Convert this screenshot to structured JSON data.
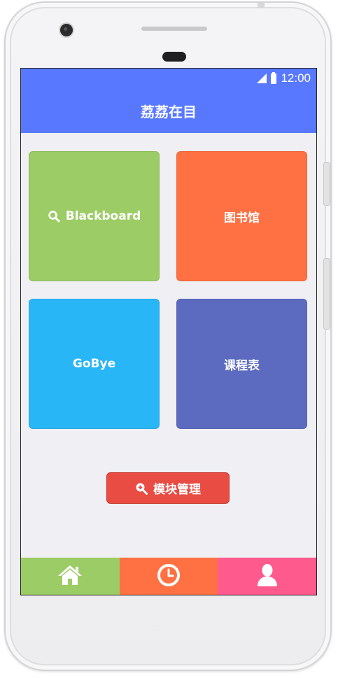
{
  "status_bar": {
    "time": "12:00",
    "signal_icon": "signal-icon",
    "battery_icon": "battery-icon"
  },
  "app_bar": {
    "title": "荔荔在目"
  },
  "tiles": [
    {
      "label": "Blackboard",
      "icon": "search-icon",
      "color": "#9ccc65"
    },
    {
      "label": "图书馆",
      "color": "#ff7043"
    },
    {
      "label": "GoBye",
      "color": "#29b6f6"
    },
    {
      "label": "课程表",
      "color": "#5c6bc0"
    }
  ],
  "module_button": {
    "label": "模块管理",
    "icon": "zoom-in-icon",
    "color": "#e84c43"
  },
  "bottom_nav": [
    {
      "icon": "home-icon",
      "color": "#9ccc65"
    },
    {
      "icon": "clock-icon",
      "color": "#ff7043"
    },
    {
      "icon": "user-icon",
      "color": "#ff5a8d"
    }
  ]
}
